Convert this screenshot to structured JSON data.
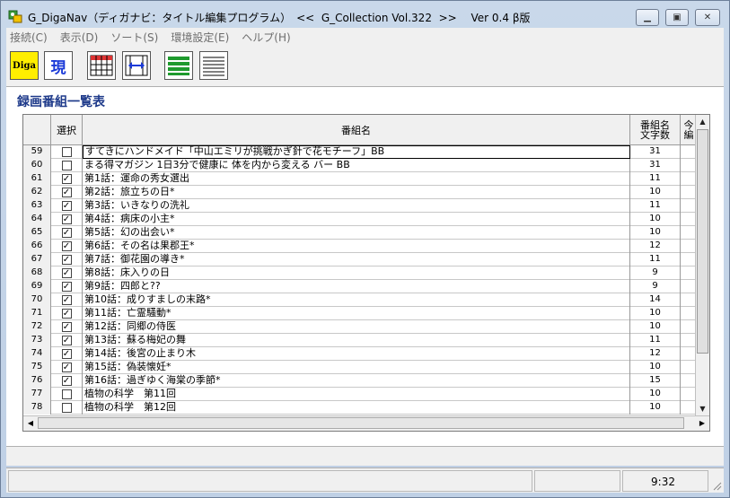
{
  "window": {
    "title": "G_DigaNav（ディガナビ：タイトル編集プログラム）　<<  G_Collection Vol.322  >>　 Ver 0.4 β版"
  },
  "menu": {
    "items": [
      "接続(C)",
      "表示(D)",
      "ソート(S)",
      "環境設定(E)",
      "ヘルプ(H)"
    ]
  },
  "toolbar": {
    "diga_label": "Diga",
    "gen_label": "現"
  },
  "section": {
    "title": "録画番組一覧表"
  },
  "table": {
    "headers": {
      "select": "選択",
      "name": "番組名",
      "length_line1": "番組名",
      "length_line2": "文字数",
      "extra_line1": "今",
      "extra_line2": "編"
    },
    "rows": [
      {
        "no": "59",
        "checked": false,
        "name": "すてきにハンドメイド「中山エミリが挑戦かぎ針で花モチーフ」BB",
        "len": "31"
      },
      {
        "no": "60",
        "checked": false,
        "name": "まる得マガジン 1日3分で健康に 体を内から変える バー BB",
        "len": "31"
      },
      {
        "no": "61",
        "checked": true,
        "name": "第1話：運命の秀女選出",
        "len": "11"
      },
      {
        "no": "62",
        "checked": true,
        "name": "第2話：旅立ちの日*",
        "len": "10"
      },
      {
        "no": "63",
        "checked": true,
        "name": "第3話：いきなりの洗礼",
        "len": "11"
      },
      {
        "no": "64",
        "checked": true,
        "name": "第4話：病床の小主*",
        "len": "10"
      },
      {
        "no": "65",
        "checked": true,
        "name": "第5話：幻の出会い*",
        "len": "10"
      },
      {
        "no": "66",
        "checked": true,
        "name": "第6話：その名は果郡王*",
        "len": "12"
      },
      {
        "no": "67",
        "checked": true,
        "name": "第7話：御花園の導き*",
        "len": "11"
      },
      {
        "no": "68",
        "checked": true,
        "name": "第8話：床入りの日",
        "len": "9"
      },
      {
        "no": "69",
        "checked": true,
        "name": "第9話：四郎と??",
        "len": "9"
      },
      {
        "no": "70",
        "checked": true,
        "name": "第10話：成りすましの末路*",
        "len": "14"
      },
      {
        "no": "71",
        "checked": true,
        "name": "第11話：亡霊騒動*",
        "len": "10"
      },
      {
        "no": "72",
        "checked": true,
        "name": "第12話：同郷の侍医",
        "len": "10"
      },
      {
        "no": "73",
        "checked": true,
        "name": "第13話：蘇る梅妃の舞",
        "len": "11"
      },
      {
        "no": "74",
        "checked": true,
        "name": "第14話：後宮の止まり木",
        "len": "12"
      },
      {
        "no": "75",
        "checked": true,
        "name": "第15話：偽装懐妊*",
        "len": "10"
      },
      {
        "no": "76",
        "checked": true,
        "name": "第16話：過ぎゆく海棠の季節*",
        "len": "15"
      },
      {
        "no": "77",
        "checked": false,
        "name": "植物の科学　第11回",
        "len": "10"
      },
      {
        "no": "78",
        "checked": false,
        "name": "植物の科学　第12回",
        "len": "10"
      }
    ]
  },
  "status": {
    "time": "9:32"
  }
}
